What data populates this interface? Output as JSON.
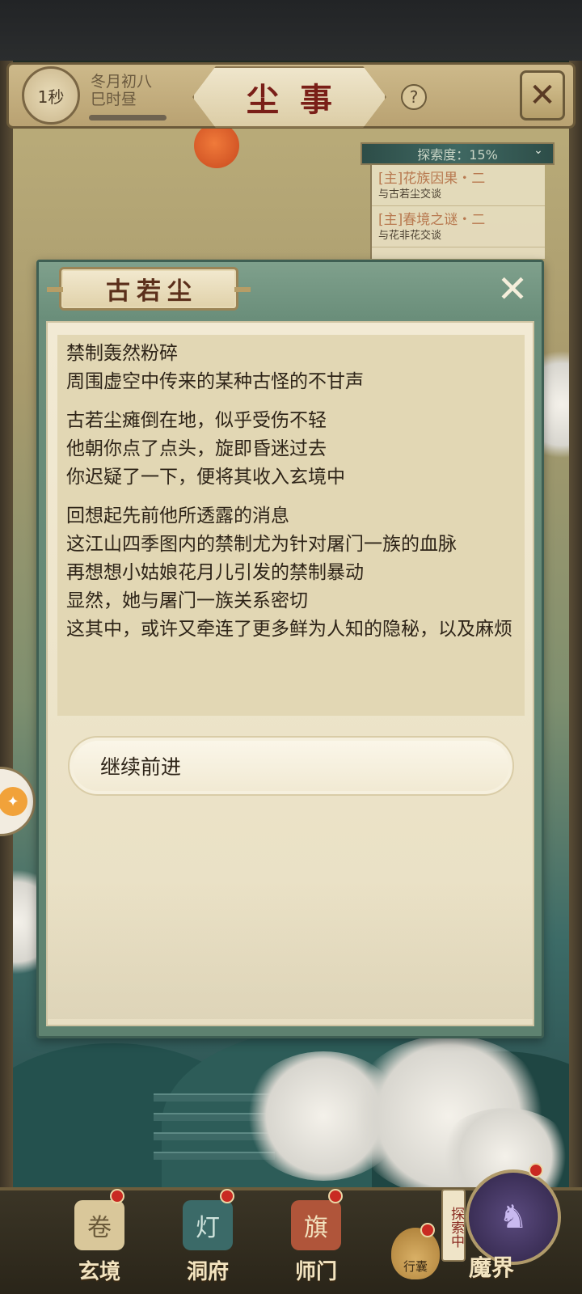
{
  "header": {
    "timer": "1秒",
    "date_line1": "冬月初八",
    "date_line2": "巳时昼",
    "title": "尘事",
    "help_symbol": "?",
    "close_symbol": "✕"
  },
  "explore": {
    "progress_label": "探索度：15%",
    "progress_value": 0.15,
    "toggle_symbol": "⌄",
    "tasks": [
      {
        "title": "[主]花族因果・二",
        "subtitle": "与古若尘交谈"
      },
      {
        "title": "[主]春境之谜・二",
        "subtitle": "与花非花交谈"
      }
    ]
  },
  "dialog": {
    "speaker": "古若尘",
    "close_symbol": "✕",
    "paragraphs": [
      [
        "禁制轰然粉碎",
        "周围虚空中传来的某种古怪的不甘声"
      ],
      [
        "古若尘瘫倒在地，似乎受伤不轻",
        "他朝你点了点头，旋即昏迷过去",
        "你迟疑了一下，便将其收入玄境中"
      ],
      [
        "回想起先前他所透露的消息",
        "这江山四季图内的禁制尤为针对屠门一族的血脉",
        "再想想小姑娘花月儿引发的禁制暴动",
        "显然，她与屠门一族关系密切",
        "这其中，或许又牵连了更多鲜为人知的隐秘，以及麻烦"
      ]
    ],
    "option": "继续前进"
  },
  "bottom_nav": {
    "items": [
      "玄境",
      "洞府",
      "师门"
    ],
    "bag_label": "行囊",
    "exploring_tag": "探索中",
    "demon_label": "魔界"
  },
  "colors": {
    "title_red": "#7a1f18",
    "task_orange": "#b87950",
    "dialog_green": "#6c8f7c",
    "paper": "#f2ead4",
    "notification_red": "#c92a22"
  }
}
